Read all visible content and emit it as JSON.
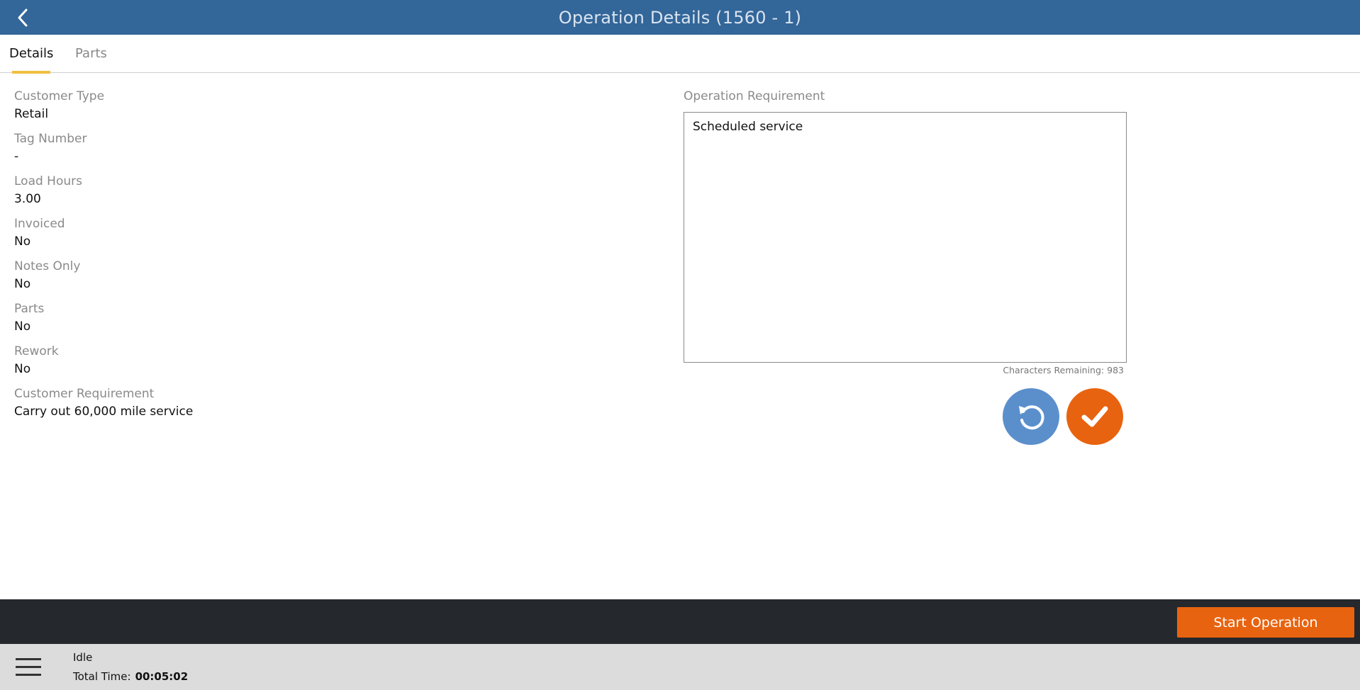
{
  "header": {
    "title": "Operation Details (1560 - 1)",
    "back_icon": "chevron-left-icon"
  },
  "tabs": [
    {
      "label": "Details",
      "active": true
    },
    {
      "label": "Parts",
      "active": false
    }
  ],
  "details": {
    "customer_type": {
      "label": "Customer Type",
      "value": "Retail"
    },
    "tag_number": {
      "label": "Tag Number",
      "value": "-"
    },
    "load_hours": {
      "label": "Load Hours",
      "value": "3.00"
    },
    "invoiced": {
      "label": "Invoiced",
      "value": "No"
    },
    "notes_only": {
      "label": "Notes Only",
      "value": "No"
    },
    "parts": {
      "label": "Parts",
      "value": "No"
    },
    "rework": {
      "label": "Rework",
      "value": "No"
    },
    "customer_requirement": {
      "label": "Customer Requirement",
      "value": "Carry out 60,000 mile service"
    }
  },
  "operation_requirement": {
    "label": "Operation Requirement",
    "text": "Scheduled service",
    "chars_remaining_label": "Characters Remaining:",
    "chars_remaining": "983"
  },
  "buttons": {
    "undo_icon": "undo-icon",
    "confirm_icon": "checkmark-icon",
    "start_operation": "Start Operation"
  },
  "footer": {
    "menu_icon": "hamburger-menu-icon",
    "status": "Idle",
    "total_time_label": "Total Time:",
    "total_time": "00:05:02"
  },
  "colors": {
    "header": "#336699",
    "accent_orange": "#e8630f",
    "accent_blue": "#5b8fcc",
    "tab_underline": "#f0c040",
    "action_bar": "#25282d",
    "footer": "#dcdcdc"
  }
}
